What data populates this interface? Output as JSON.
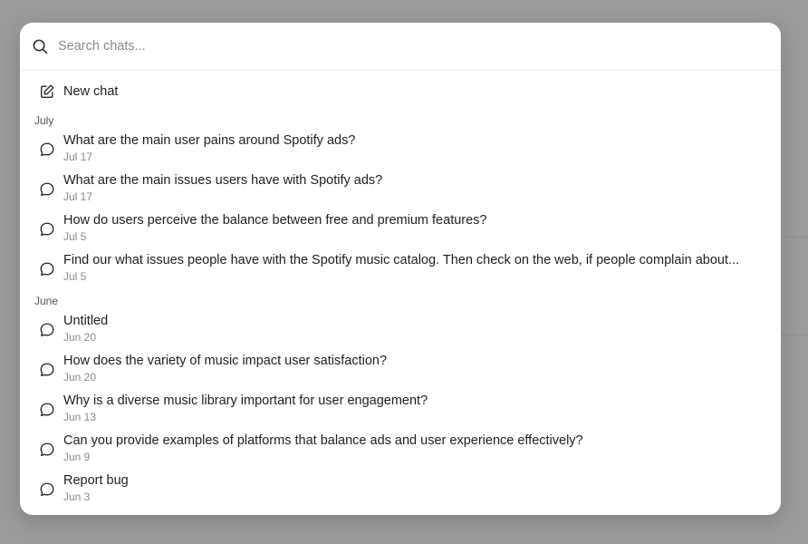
{
  "search": {
    "placeholder": "Search chats...",
    "value": ""
  },
  "new_chat": {
    "label": "New chat"
  },
  "groups": [
    {
      "label": "July",
      "items": [
        {
          "title": "What are the main user pains around Spotify ads?",
          "date": "Jul 17"
        },
        {
          "title": "What are the main issues users have with Spotify ads?",
          "date": "Jul 17"
        },
        {
          "title": "How do users perceive the balance between free and premium features?",
          "date": "Jul 5"
        },
        {
          "title": "Find our what issues people have with the Spotify music catalog. Then check on the web, if people complain about...",
          "date": "Jul 5"
        }
      ]
    },
    {
      "label": "June",
      "items": [
        {
          "title": "Untitled",
          "date": "Jun 20"
        },
        {
          "title": "How does the variety of music impact user satisfaction?",
          "date": "Jun 20"
        },
        {
          "title": "Why is a diverse music library important for user engagement?",
          "date": "Jun 13"
        },
        {
          "title": "Can you provide examples of platforms that balance ads and user experience effectively?",
          "date": "Jun 9"
        },
        {
          "title": "Report bug",
          "date": "Jun 3"
        }
      ]
    }
  ],
  "colors": {
    "backdrop": "#9b9b9b",
    "modal_bg": "#ffffff",
    "text_primary": "#1f1f1f",
    "text_secondary": "#8a8a8a"
  },
  "icons": {
    "search": "search-icon",
    "new_chat": "edit-icon",
    "chat": "chat-bubble-icon"
  }
}
